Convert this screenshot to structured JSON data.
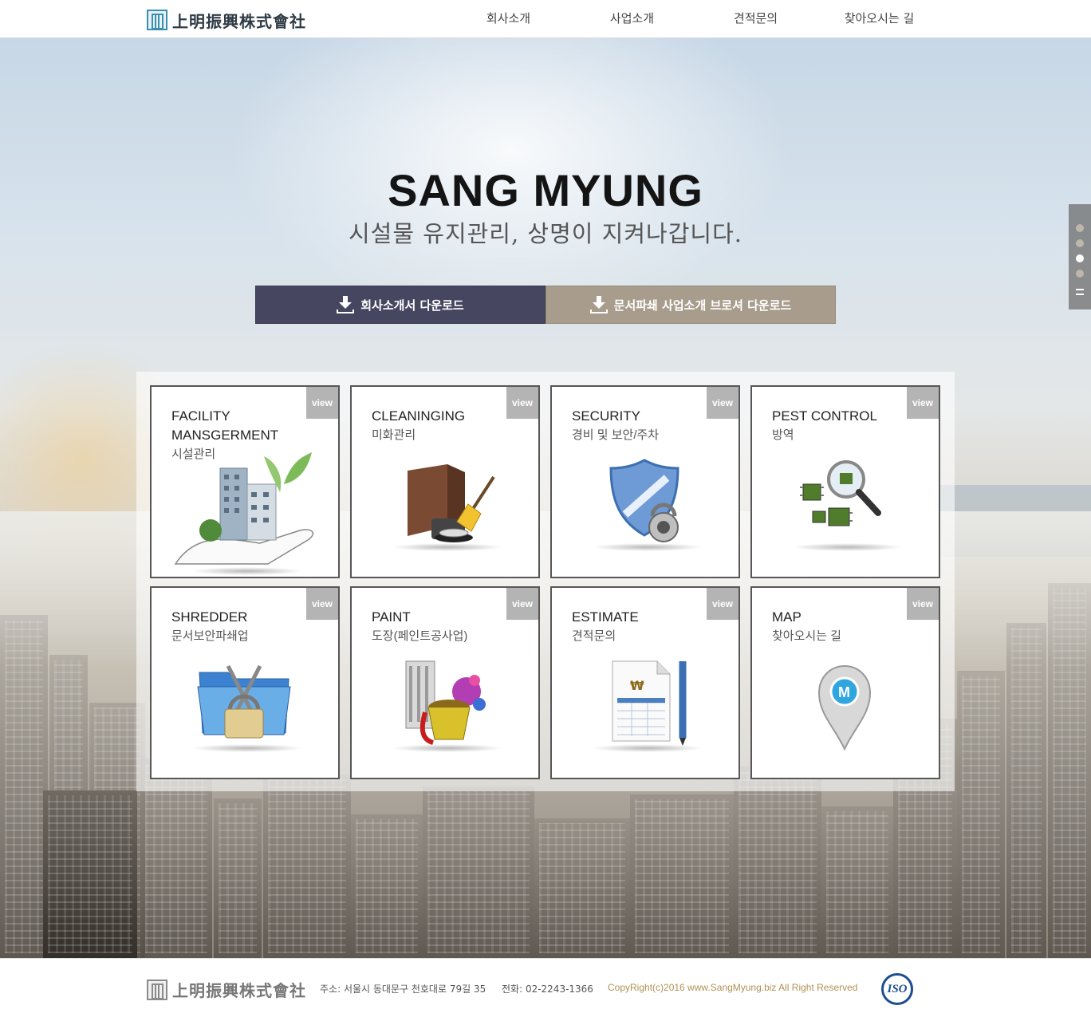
{
  "header": {
    "logo_text": "上明振興株式會社",
    "nav": [
      "회사소개",
      "사업소개",
      "견적문의",
      "찾아오시는 길"
    ]
  },
  "hero": {
    "title": "SANG MYUNG",
    "subtitle": "시설물 유지관리, 상명이 지켜나갑니다.",
    "buttons": {
      "company_intro": "회사소개서 다운로드",
      "brochure": "문서파쇄 사업소개 브로셔 다운로드"
    },
    "pager": {
      "count": 4,
      "active_index": 2
    }
  },
  "services": [
    {
      "en": "FACILITY MANSGERMENT",
      "ko": "시설관리",
      "view": "view",
      "icon": "building-in-hand-icon"
    },
    {
      "en": "CLEANINGING",
      "ko": "미화관리",
      "view": "view",
      "icon": "cleaning-box-broom-icon"
    },
    {
      "en": "SECURITY",
      "ko": "경비 및 보안/주차",
      "view": "view",
      "icon": "shield-lock-icon"
    },
    {
      "en": "PEST CONTROL",
      "ko": "방역",
      "view": "view",
      "icon": "magnifier-bugs-icon"
    },
    {
      "en": "SHREDDER",
      "ko": "문서보안파쇄업",
      "view": "view",
      "icon": "folder-scissors-lock-icon"
    },
    {
      "en": "PAINT",
      "ko": "도장(페인트공사업)",
      "view": "view",
      "icon": "paint-bucket-icon"
    },
    {
      "en": "ESTIMATE",
      "ko": "견적문의",
      "view": "view",
      "icon": "invoice-pen-icon"
    },
    {
      "en": "MAP",
      "ko": "찾아오시는 길",
      "view": "view",
      "icon": "map-pin-icon"
    }
  ],
  "footer": {
    "logo_text": "上明振興株式會社",
    "address": "주소: 서울시 동대문구 천호대로 79길 35",
    "phone": "전화: 02-2243-1366",
    "copyright": "CopyRight(c)2016 www.SangMyung.biz All Right Reserved",
    "iso_label": "ISO"
  },
  "colors": {
    "button_primary": "#474661",
    "button_secondary": "#a89c8c",
    "view_tag": "#b4b4b4",
    "copyright": "#b09255"
  }
}
